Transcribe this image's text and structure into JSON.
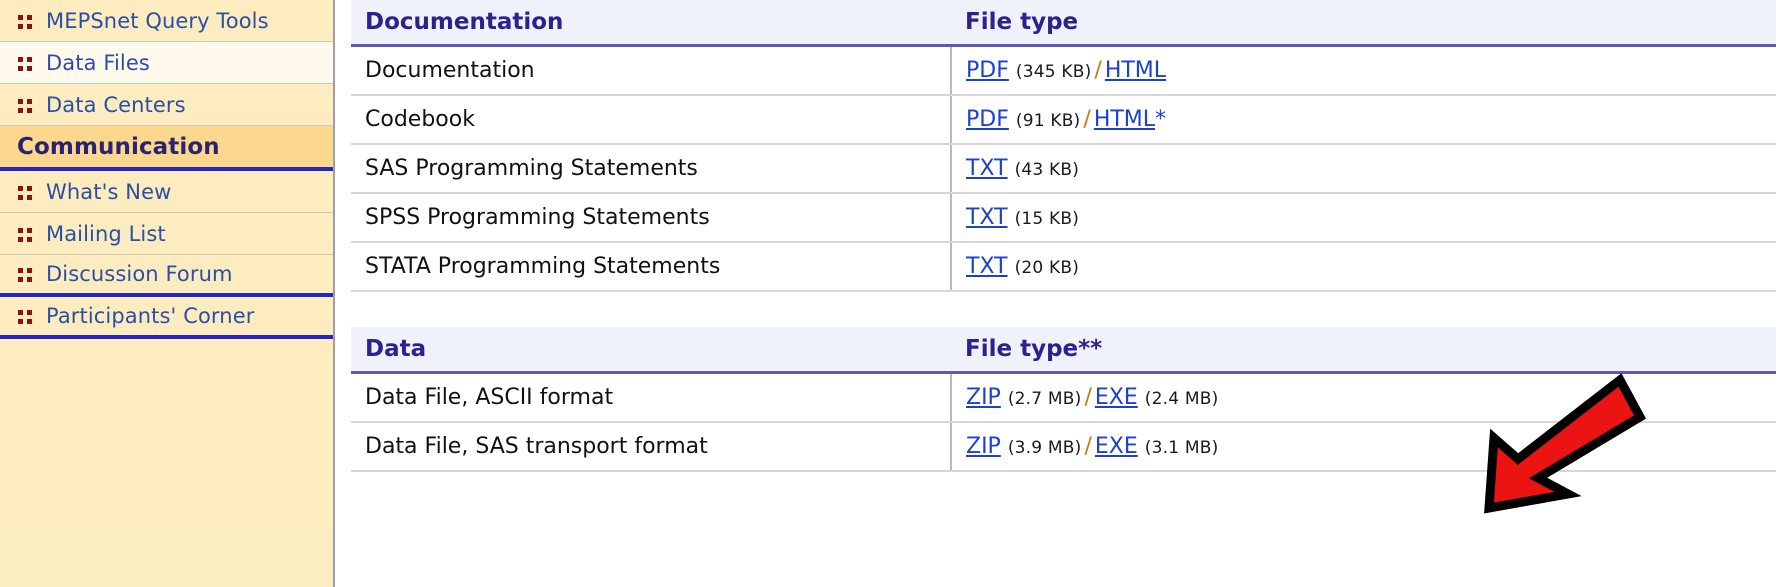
{
  "sidebar": {
    "items": [
      {
        "label": "MEPSnet Query Tools",
        "type": "link",
        "icon": "four-dots-icon",
        "shade": "normal"
      },
      {
        "label": "Data Files",
        "type": "link",
        "icon": "four-dots-icon",
        "shade": "alt"
      },
      {
        "label": "Data Centers",
        "type": "link",
        "icon": "four-dots-icon",
        "shade": "normal"
      },
      {
        "label": "Communication",
        "type": "section",
        "icon": null,
        "shade": "section"
      },
      {
        "label": "What's New",
        "type": "link",
        "icon": "four-dots-icon",
        "shade": "normal"
      },
      {
        "label": "Mailing List",
        "type": "link",
        "icon": "four-dots-icon",
        "shade": "normal"
      },
      {
        "label": "Discussion Forum",
        "type": "link",
        "icon": "four-dots-icon",
        "shade": "normal"
      },
      {
        "label": "Participants' Corner",
        "type": "link",
        "icon": "four-dots-icon",
        "shade": "normal"
      }
    ]
  },
  "tables": [
    {
      "headers": {
        "name": "Documentation",
        "filetype": "File type"
      },
      "rows": [
        {
          "name": "Documentation",
          "files": [
            {
              "label": "PDF",
              "size": "(345 KB)",
              "asterisk": ""
            },
            {
              "label": "HTML",
              "size": "",
              "asterisk": ""
            }
          ]
        },
        {
          "name": "Codebook",
          "files": [
            {
              "label": "PDF",
              "size": "(91 KB)",
              "asterisk": ""
            },
            {
              "label": "HTML",
              "size": "",
              "asterisk": "*"
            }
          ]
        },
        {
          "name": "SAS Programming Statements",
          "files": [
            {
              "label": "TXT",
              "size": "(43 KB)",
              "asterisk": ""
            }
          ]
        },
        {
          "name": "SPSS Programming Statements",
          "files": [
            {
              "label": "TXT",
              "size": "(15 KB)",
              "asterisk": ""
            }
          ]
        },
        {
          "name": "STATA Programming Statements",
          "files": [
            {
              "label": "TXT",
              "size": "(20 KB)",
              "asterisk": ""
            }
          ]
        }
      ]
    },
    {
      "headers": {
        "name": "Data",
        "filetype": "File type**"
      },
      "rows": [
        {
          "name": "Data File, ASCII format",
          "files": [
            {
              "label": "ZIP",
              "size": "(2.7 MB)",
              "asterisk": ""
            },
            {
              "label": "EXE",
              "size": "(2.4 MB)",
              "asterisk": ""
            }
          ]
        },
        {
          "name": "Data File, SAS transport format",
          "files": [
            {
              "label": "ZIP",
              "size": "(3.9 MB)",
              "asterisk": ""
            },
            {
              "label": "EXE",
              "size": "(3.1 MB)",
              "asterisk": ""
            }
          ]
        }
      ]
    }
  ],
  "annotation": {
    "type": "red-arrow",
    "direction": "down-left",
    "color": "#ec1313",
    "outline": "#000000"
  },
  "separator": "/",
  "colors": {
    "sidebar_bg": "#fcecc0",
    "sidebar_alt_bg": "#fffaeb",
    "sidebar_section_bg": "#fbd88e",
    "sidebar_rule": "#2727c0",
    "link": "#1c40d0",
    "nav_link": "#2b4fa6",
    "header_bg": "#eff1fb",
    "header_text": "#2b2290",
    "bullet": "#8a1212",
    "arrow_red": "#ec1313"
  }
}
